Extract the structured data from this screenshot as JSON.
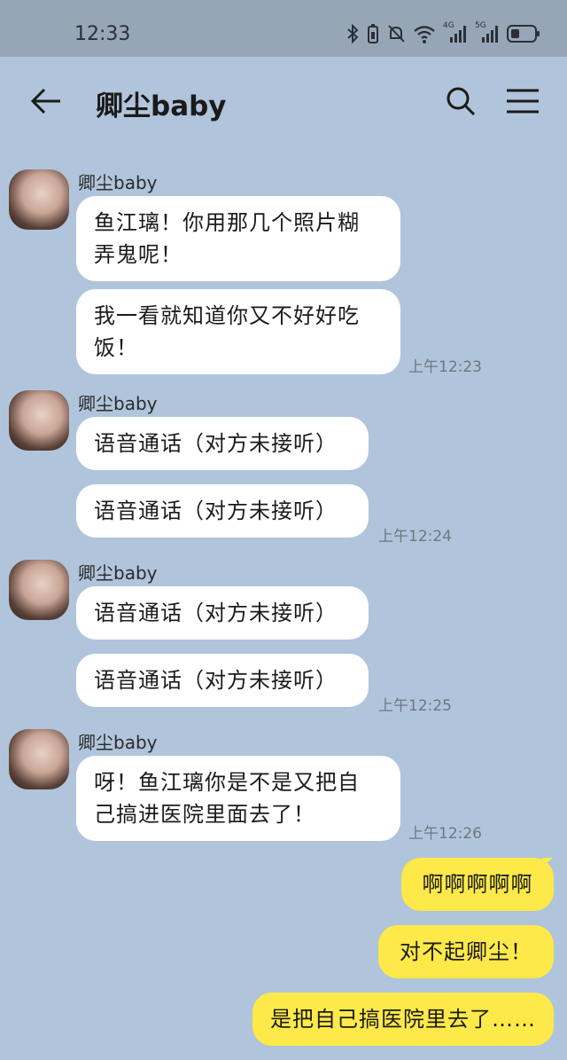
{
  "status_bar": {
    "time": "12:33",
    "net1": "4G",
    "net2": "5G"
  },
  "header": {
    "title": "卿尘baby"
  },
  "messages": {
    "g1": {
      "sender": "卿尘baby",
      "m1": "鱼江璃！你用那几个照片糊弄鬼呢！",
      "m1a": "鱼江璃！你用那几个照片糊",
      "m1b": "弄鬼呢！",
      "m2a": "我一看就知道你又不好好吃",
      "m2b": "饭！",
      "time": "上午12:23"
    },
    "g2": {
      "sender": "卿尘baby",
      "m1": "语音通话（对方未接听）",
      "m2": "语音通话（对方未接听）",
      "time": "上午12:24"
    },
    "g3": {
      "sender": "卿尘baby",
      "m1": "语音通话（对方未接听）",
      "m2": "语音通话（对方未接听）",
      "time": "上午12:25"
    },
    "g4": {
      "sender": "卿尘baby",
      "m1a": "呀！鱼江璃你是不是又把自",
      "m1b": "己搞进医院里面去了！",
      "time": "上午12:26"
    },
    "me": {
      "m1": "啊啊啊啊啊",
      "m2": "对不起卿尘！",
      "m3": "是把自己搞医院里去了……"
    }
  },
  "colors": {
    "background": "#b0c5db",
    "status_bar": "#97a6b7",
    "incoming_bubble": "#ffffff",
    "outgoing_bubble": "#fde949"
  },
  "icons": [
    "back-arrow-icon",
    "search-icon",
    "menu-icon",
    "bluetooth-icon",
    "battery-saver-icon",
    "mute-icon",
    "wifi-icon",
    "signal-icon",
    "battery-icon"
  ]
}
